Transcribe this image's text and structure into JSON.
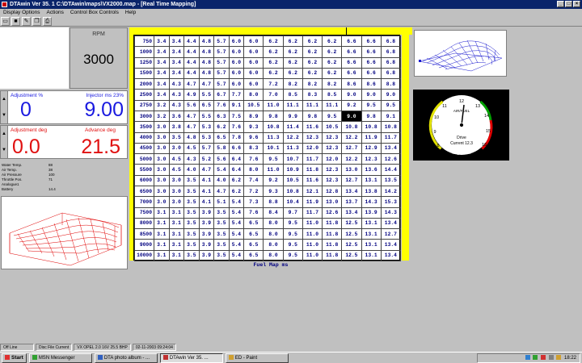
{
  "window": {
    "title": "DTAwin Ver  35. 1  C:\\DTAwin\\maps\\VX2000.map - [Real Time Mapping]"
  },
  "menu": [
    "Display Options",
    "Actions",
    "Control Box Controls",
    "Help"
  ],
  "toolbar": [
    "open-icon",
    "save-icon",
    "edit-icon",
    "copy-icon",
    "print-icon"
  ],
  "rpm": {
    "label": "RPM",
    "value": "3000"
  },
  "injection": {
    "adj_label": "Adjustment %",
    "adj_value": "0",
    "inj_label": "Injector ms 23%",
    "inj_value": "9.00"
  },
  "ignition": {
    "adj_label": "Adjustment deg",
    "adj_value": "0.0",
    "adv_label": "Advance deg",
    "adv_value": "21.5"
  },
  "sensors": [
    {
      "name": "Water Temp.",
      "value": "88"
    },
    {
      "name": "Air Temp.",
      "value": "38"
    },
    {
      "name": "Air Pressure",
      "value": "100"
    },
    {
      "name": "Throttle Pos.",
      "value": "71"
    },
    {
      "name": "Analogue1",
      "value": ""
    },
    {
      "name": "Battery",
      "value": "14.4"
    }
  ],
  "map": {
    "title": "Fuel Map ms",
    "rows": [
      {
        "rpm": "750",
        "cells": [
          "3.4",
          "3.4",
          "4.4",
          "4.8",
          "5.7",
          "6.0",
          "6.0",
          "6.2",
          "6.2",
          "6.2",
          "6.2",
          "6.6",
          "6.6",
          "6.8"
        ]
      },
      {
        "rpm": "1000",
        "cells": [
          "3.4",
          "3.4",
          "4.4",
          "4.8",
          "5.7",
          "6.0",
          "6.0",
          "6.2",
          "6.2",
          "6.2",
          "6.2",
          "6.6",
          "6.6",
          "6.8"
        ]
      },
      {
        "rpm": "1250",
        "cells": [
          "3.4",
          "3.4",
          "4.4",
          "4.8",
          "5.7",
          "6.0",
          "6.0",
          "6.2",
          "6.2",
          "6.2",
          "6.2",
          "6.6",
          "6.6",
          "6.8"
        ]
      },
      {
        "rpm": "1500",
        "cells": [
          "3.4",
          "3.4",
          "4.4",
          "4.8",
          "5.7",
          "6.0",
          "6.0",
          "6.2",
          "6.2",
          "6.2",
          "6.2",
          "6.6",
          "6.6",
          "6.8"
        ]
      },
      {
        "rpm": "2000",
        "cells": [
          "3.4",
          "4.3",
          "4.7",
          "4.7",
          "5.7",
          "6.0",
          "6.0",
          "7.2",
          "8.2",
          "8.2",
          "8.2",
          "8.6",
          "8.6",
          "8.8"
        ]
      },
      {
        "rpm": "2500",
        "cells": [
          "3.4",
          "4.3",
          "4.9",
          "5.5",
          "6.7",
          "7.7",
          "8.0",
          "7.0",
          "8.5",
          "8.3",
          "8.5",
          "9.0",
          "9.0",
          "9.0"
        ]
      },
      {
        "rpm": "2750",
        "cells": [
          "3.2",
          "4.3",
          "5.6",
          "6.5",
          "7.6",
          "9.1",
          "10.5",
          "11.0",
          "11.1",
          "11.1",
          "11.1",
          "9.2",
          "9.5",
          "9.5"
        ]
      },
      {
        "rpm": "3000",
        "cells": [
          "3.2",
          "3.6",
          "4.7",
          "5.5",
          "6.3",
          "7.5",
          "8.9",
          "9.8",
          "9.9",
          "9.8",
          "9.5",
          "9.0",
          "9.8",
          "9.1"
        ]
      },
      {
        "rpm": "3500",
        "cells": [
          "3.0",
          "3.8",
          "4.7",
          "5.3",
          "6.2",
          "7.6",
          "9.3",
          "10.8",
          "11.4",
          "11.6",
          "10.5",
          "10.8",
          "10.8",
          "10.8"
        ]
      },
      {
        "rpm": "4000",
        "cells": [
          "3.0",
          "3.5",
          "4.8",
          "5.3",
          "6.5",
          "7.8",
          "9.6",
          "11.3",
          "12.2",
          "12.3",
          "12.3",
          "12.2",
          "11.9",
          "11.7"
        ]
      },
      {
        "rpm": "4500",
        "cells": [
          "3.0",
          "3.0",
          "4.5",
          "5.7",
          "5.8",
          "6.6",
          "8.3",
          "10.1",
          "11.3",
          "12.0",
          "12.3",
          "12.7",
          "12.9",
          "13.4"
        ]
      },
      {
        "rpm": "5000",
        "cells": [
          "3.0",
          "4.5",
          "4.3",
          "5.2",
          "5.6",
          "6.4",
          "7.6",
          "9.5",
          "10.7",
          "11.7",
          "12.0",
          "12.2",
          "12.3",
          "12.6"
        ]
      },
      {
        "rpm": "5500",
        "cells": [
          "3.0",
          "4.5",
          "4.0",
          "4.7",
          "5.4",
          "6.4",
          "8.0",
          "11.0",
          "10.9",
          "11.8",
          "12.3",
          "13.0",
          "13.6",
          "14.4"
        ]
      },
      {
        "rpm": "6000",
        "cells": [
          "3.0",
          "3.0",
          "3.5",
          "4.1",
          "4.0",
          "6.2",
          "7.4",
          "9.2",
          "10.5",
          "11.6",
          "12.3",
          "12.7",
          "13.1",
          "13.5"
        ]
      },
      {
        "rpm": "6500",
        "cells": [
          "3.0",
          "3.0",
          "3.5",
          "4.1",
          "4.7",
          "6.2",
          "7.2",
          "9.3",
          "10.8",
          "12.1",
          "12.8",
          "13.4",
          "13.8",
          "14.2"
        ]
      },
      {
        "rpm": "7000",
        "cells": [
          "3.0",
          "3.0",
          "3.5",
          "4.1",
          "5.1",
          "5.4",
          "7.3",
          "8.8",
          "10.4",
          "11.9",
          "13.0",
          "13.7",
          "14.3",
          "15.3"
        ]
      },
      {
        "rpm": "7500",
        "cells": [
          "3.1",
          "3.1",
          "3.5",
          "3.9",
          "3.5",
          "5.4",
          "7.6",
          "8.4",
          "9.7",
          "11.7",
          "12.6",
          "13.4",
          "13.9",
          "14.3"
        ]
      },
      {
        "rpm": "8000",
        "cells": [
          "3.1",
          "3.1",
          "3.5",
          "3.9",
          "3.5",
          "5.4",
          "6.5",
          "8.0",
          "9.5",
          "11.0",
          "11.8",
          "12.5",
          "13.1",
          "13.4"
        ]
      },
      {
        "rpm": "8500",
        "cells": [
          "3.1",
          "3.1",
          "3.5",
          "3.9",
          "3.5",
          "5.4",
          "6.5",
          "8.0",
          "9.5",
          "11.0",
          "11.8",
          "12.5",
          "13.1",
          "12.7"
        ]
      },
      {
        "rpm": "9000",
        "cells": [
          "3.1",
          "3.1",
          "3.5",
          "3.9",
          "3.5",
          "5.4",
          "6.5",
          "8.0",
          "9.5",
          "11.0",
          "11.8",
          "12.5",
          "13.1",
          "13.4"
        ]
      },
      {
        "rpm": "10000",
        "cells": [
          "3.1",
          "3.1",
          "3.5",
          "3.9",
          "3.5",
          "5.4",
          "6.5",
          "8.0",
          "9.5",
          "11.0",
          "11.8",
          "12.5",
          "13.1",
          "13.4"
        ]
      }
    ],
    "selected": {
      "row": 7,
      "col": 11
    }
  },
  "gauge": {
    "label": "AIR/FUEL",
    "ticks": [
      "8",
      "9",
      "10",
      "11",
      "12",
      "13",
      "14",
      "15",
      "16"
    ],
    "status": "Drive",
    "current": "Current 12.3",
    "target": "Target 13.7"
  },
  "status": [
    "Off Line",
    "Disc File Current",
    "VX OPEL 2.0 16V 25.5 BHP",
    "02-11-2003 09:24:04"
  ],
  "taskbar": {
    "start": "Start",
    "tasks": [
      "MSN Messenger",
      "DTA photo album - ...",
      "DTAwin Ver  35. ...",
      "ED - Paint"
    ],
    "active": 2,
    "clock": "18:22"
  },
  "colors": {
    "title": "#0a246a",
    "map_bg": "#ffff00",
    "value_blue": "#1a1ae0",
    "value_red": "#e01010",
    "map_text": "#000080"
  }
}
